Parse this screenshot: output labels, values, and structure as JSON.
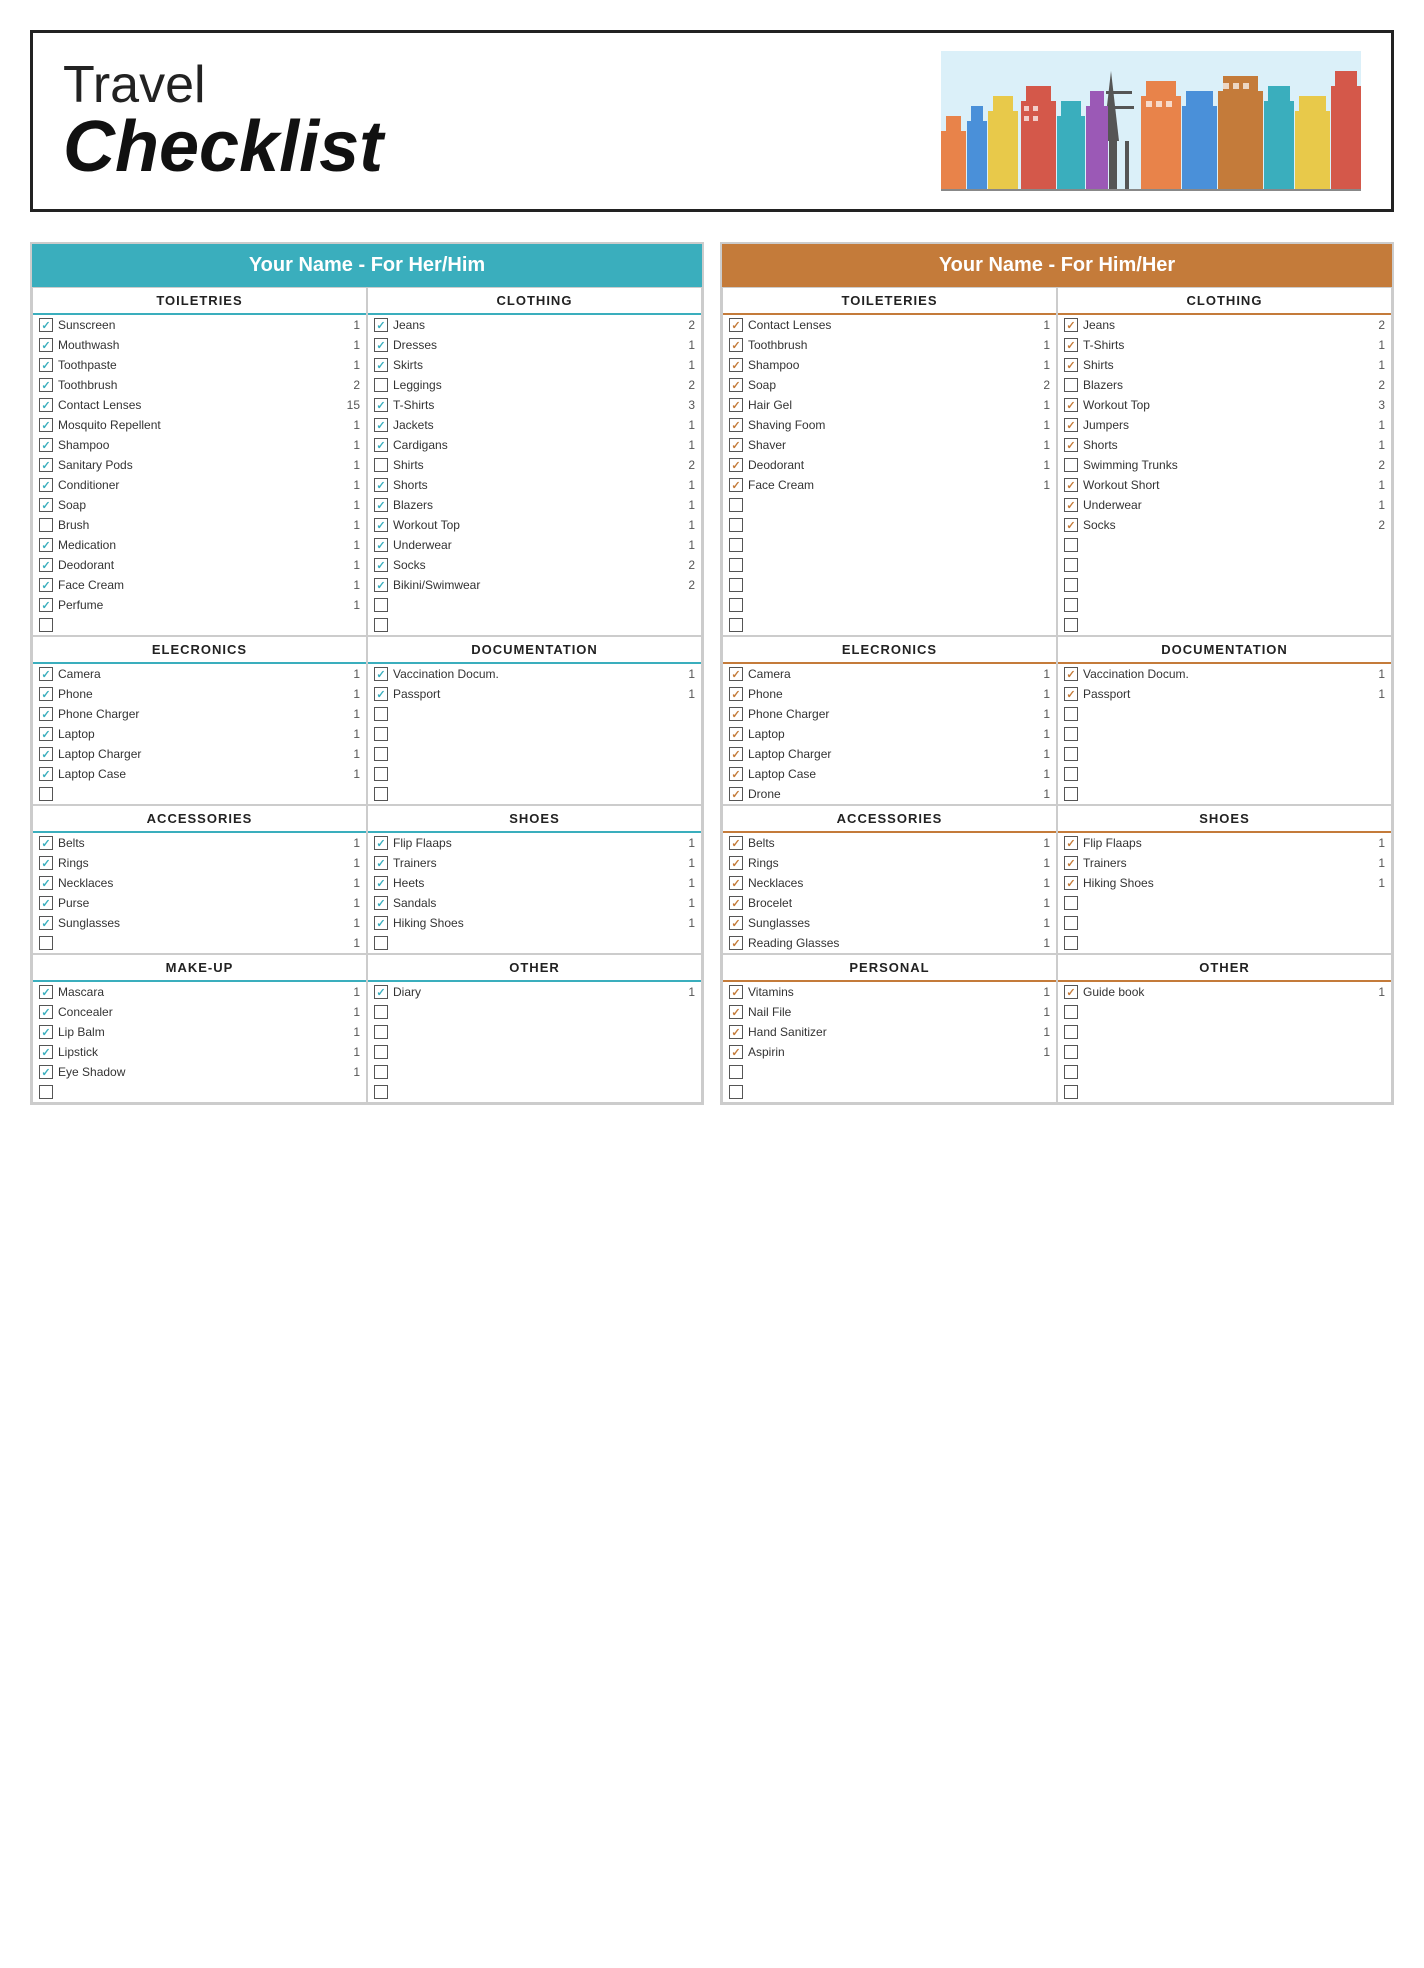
{
  "header": {
    "travel": "Travel",
    "checklist": "Checklist"
  },
  "panels": [
    {
      "id": "her",
      "headerLabel": "Your Name - For Her/Him",
      "headerClass": "blue",
      "sections": [
        {
          "title": "TOILETRIES",
          "titleBorder": "blue",
          "items": [
            {
              "checked": true,
              "name": "Sunscreen",
              "qty": "1"
            },
            {
              "checked": true,
              "name": "Mouthwash",
              "qty": "1"
            },
            {
              "checked": true,
              "name": "Toothpaste",
              "qty": "1"
            },
            {
              "checked": true,
              "name": "Toothbrush",
              "qty": "2"
            },
            {
              "checked": true,
              "name": "Contact Lenses",
              "qty": "15"
            },
            {
              "checked": true,
              "name": "Mosquito Repellent",
              "qty": "1"
            },
            {
              "checked": true,
              "name": "Shampoo",
              "qty": "1"
            },
            {
              "checked": true,
              "name": "Sanitary Pods",
              "qty": "1"
            },
            {
              "checked": true,
              "name": "Conditioner",
              "qty": "1"
            },
            {
              "checked": true,
              "name": "Soap",
              "qty": "1"
            },
            {
              "checked": false,
              "name": "Brush",
              "qty": "1"
            },
            {
              "checked": true,
              "name": "Medication",
              "qty": "1"
            },
            {
              "checked": true,
              "name": "Deodorant",
              "qty": "1"
            },
            {
              "checked": true,
              "name": "Face Cream",
              "qty": "1"
            },
            {
              "checked": true,
              "name": "Perfume",
              "qty": "1"
            },
            {
              "checked": false,
              "name": "",
              "qty": ""
            }
          ]
        },
        {
          "title": "CLOTHING",
          "titleBorder": "blue",
          "items": [
            {
              "checked": true,
              "name": "Jeans",
              "qty": "2"
            },
            {
              "checked": true,
              "name": "Dresses",
              "qty": "1"
            },
            {
              "checked": true,
              "name": "Skirts",
              "qty": "1"
            },
            {
              "checked": false,
              "name": "Leggings",
              "qty": "2"
            },
            {
              "checked": true,
              "name": "T-Shirts",
              "qty": "3"
            },
            {
              "checked": true,
              "name": "Jackets",
              "qty": "1"
            },
            {
              "checked": true,
              "name": "Cardigans",
              "qty": "1"
            },
            {
              "checked": false,
              "name": "Shirts",
              "qty": "2"
            },
            {
              "checked": true,
              "name": "Shorts",
              "qty": "1"
            },
            {
              "checked": true,
              "name": "Blazers",
              "qty": "1"
            },
            {
              "checked": true,
              "name": "Workout Top",
              "qty": "1"
            },
            {
              "checked": true,
              "name": "Underwear",
              "qty": "1"
            },
            {
              "checked": true,
              "name": "Socks",
              "qty": "2"
            },
            {
              "checked": true,
              "name": "Bikini/Swimwear",
              "qty": "2"
            },
            {
              "checked": false,
              "name": "",
              "qty": ""
            },
            {
              "checked": false,
              "name": "",
              "qty": ""
            }
          ]
        },
        {
          "title": "ELECRONICS",
          "titleBorder": "blue",
          "items": [
            {
              "checked": true,
              "name": "Camera",
              "qty": "1"
            },
            {
              "checked": true,
              "name": "Phone",
              "qty": "1"
            },
            {
              "checked": true,
              "name": "Phone Charger",
              "qty": "1"
            },
            {
              "checked": true,
              "name": "Laptop",
              "qty": "1"
            },
            {
              "checked": true,
              "name": "Laptop Charger",
              "qty": "1"
            },
            {
              "checked": true,
              "name": "Laptop Case",
              "qty": "1"
            },
            {
              "checked": false,
              "name": "",
              "qty": ""
            }
          ]
        },
        {
          "title": "DOCUMENTATION",
          "titleBorder": "blue",
          "items": [
            {
              "checked": true,
              "name": "Vaccination Docum.",
              "qty": "1"
            },
            {
              "checked": true,
              "name": "Passport",
              "qty": "1"
            },
            {
              "checked": false,
              "name": "",
              "qty": ""
            },
            {
              "checked": false,
              "name": "",
              "qty": ""
            },
            {
              "checked": false,
              "name": "",
              "qty": ""
            },
            {
              "checked": false,
              "name": "",
              "qty": ""
            },
            {
              "checked": false,
              "name": "",
              "qty": ""
            }
          ]
        },
        {
          "title": "ACCESSORIES",
          "titleBorder": "blue",
          "items": [
            {
              "checked": true,
              "name": "Belts",
              "qty": "1"
            },
            {
              "checked": true,
              "name": "Rings",
              "qty": "1"
            },
            {
              "checked": true,
              "name": "Necklaces",
              "qty": "1"
            },
            {
              "checked": true,
              "name": "Purse",
              "qty": "1"
            },
            {
              "checked": true,
              "name": "Sunglasses",
              "qty": "1"
            },
            {
              "checked": false,
              "name": "",
              "qty": "1"
            }
          ]
        },
        {
          "title": "SHOES",
          "titleBorder": "blue",
          "items": [
            {
              "checked": true,
              "name": "Flip Flaaps",
              "qty": "1"
            },
            {
              "checked": true,
              "name": "Trainers",
              "qty": "1"
            },
            {
              "checked": true,
              "name": "Heets",
              "qty": "1"
            },
            {
              "checked": true,
              "name": "Sandals",
              "qty": "1"
            },
            {
              "checked": true,
              "name": "Hiking Shoes",
              "qty": "1"
            },
            {
              "checked": false,
              "name": "",
              "qty": ""
            }
          ]
        },
        {
          "title": "MAKE-UP",
          "titleBorder": "blue",
          "items": [
            {
              "checked": true,
              "name": "Mascara",
              "qty": "1"
            },
            {
              "checked": true,
              "name": "Concealer",
              "qty": "1"
            },
            {
              "checked": true,
              "name": "Lip Balm",
              "qty": "1"
            },
            {
              "checked": true,
              "name": "Lipstick",
              "qty": "1"
            },
            {
              "checked": true,
              "name": "Eye Shadow",
              "qty": "1"
            },
            {
              "checked": false,
              "name": "",
              "qty": ""
            }
          ]
        },
        {
          "title": "OTHER",
          "titleBorder": "blue",
          "items": [
            {
              "checked": true,
              "name": "Diary",
              "qty": "1"
            },
            {
              "checked": false,
              "name": "",
              "qty": ""
            },
            {
              "checked": false,
              "name": "",
              "qty": ""
            },
            {
              "checked": false,
              "name": "",
              "qty": ""
            },
            {
              "checked": false,
              "name": "",
              "qty": ""
            },
            {
              "checked": false,
              "name": "",
              "qty": ""
            }
          ]
        }
      ]
    },
    {
      "id": "him",
      "headerLabel": "Your Name - For Him/Her",
      "headerClass": "brown",
      "sections": [
        {
          "title": "TOILETERIES",
          "titleBorder": "brown",
          "items": [
            {
              "checked": true,
              "name": "Contact Lenses",
              "qty": "1"
            },
            {
              "checked": true,
              "name": "Toothbrush",
              "qty": "1"
            },
            {
              "checked": true,
              "name": "Shampoo",
              "qty": "1"
            },
            {
              "checked": true,
              "name": "Soap",
              "qty": "2"
            },
            {
              "checked": true,
              "name": "Hair Gel",
              "qty": "1"
            },
            {
              "checked": true,
              "name": "Shaving Foom",
              "qty": "1"
            },
            {
              "checked": true,
              "name": "Shaver",
              "qty": "1"
            },
            {
              "checked": true,
              "name": "Deodorant",
              "qty": "1"
            },
            {
              "checked": true,
              "name": "Face Cream",
              "qty": "1"
            },
            {
              "checked": false,
              "name": "",
              "qty": ""
            },
            {
              "checked": false,
              "name": "",
              "qty": ""
            },
            {
              "checked": false,
              "name": "",
              "qty": ""
            },
            {
              "checked": false,
              "name": "",
              "qty": ""
            },
            {
              "checked": false,
              "name": "",
              "qty": ""
            },
            {
              "checked": false,
              "name": "",
              "qty": ""
            },
            {
              "checked": false,
              "name": "",
              "qty": ""
            }
          ]
        },
        {
          "title": "CLOTHING",
          "titleBorder": "brown",
          "items": [
            {
              "checked": true,
              "name": "Jeans",
              "qty": "2"
            },
            {
              "checked": true,
              "name": "T-Shirts",
              "qty": "1"
            },
            {
              "checked": true,
              "name": "Shirts",
              "qty": "1"
            },
            {
              "checked": false,
              "name": "Blazers",
              "qty": "2"
            },
            {
              "checked": true,
              "name": "Workout Top",
              "qty": "3"
            },
            {
              "checked": true,
              "name": "Jumpers",
              "qty": "1"
            },
            {
              "checked": true,
              "name": "Shorts",
              "qty": "1"
            },
            {
              "checked": false,
              "name": "Swimming Trunks",
              "qty": "2"
            },
            {
              "checked": true,
              "name": "Workout Short",
              "qty": "1"
            },
            {
              "checked": true,
              "name": "Underwear",
              "qty": "1"
            },
            {
              "checked": true,
              "name": "Socks",
              "qty": "2"
            },
            {
              "checked": false,
              "name": "",
              "qty": ""
            },
            {
              "checked": false,
              "name": "",
              "qty": ""
            },
            {
              "checked": false,
              "name": "",
              "qty": ""
            },
            {
              "checked": false,
              "name": "",
              "qty": ""
            },
            {
              "checked": false,
              "name": "",
              "qty": ""
            }
          ]
        },
        {
          "title": "ELECRONICS",
          "titleBorder": "brown",
          "items": [
            {
              "checked": true,
              "name": "Camera",
              "qty": "1"
            },
            {
              "checked": true,
              "name": "Phone",
              "qty": "1"
            },
            {
              "checked": true,
              "name": "Phone Charger",
              "qty": "1"
            },
            {
              "checked": true,
              "name": "Laptop",
              "qty": "1"
            },
            {
              "checked": true,
              "name": "Laptop Charger",
              "qty": "1"
            },
            {
              "checked": true,
              "name": "Laptop Case",
              "qty": "1"
            },
            {
              "checked": true,
              "name": "Drone",
              "qty": "1"
            }
          ]
        },
        {
          "title": "DOCUMENTATION",
          "titleBorder": "brown",
          "items": [
            {
              "checked": true,
              "name": "Vaccination Docum.",
              "qty": "1"
            },
            {
              "checked": true,
              "name": "Passport",
              "qty": "1"
            },
            {
              "checked": false,
              "name": "",
              "qty": ""
            },
            {
              "checked": false,
              "name": "",
              "qty": ""
            },
            {
              "checked": false,
              "name": "",
              "qty": ""
            },
            {
              "checked": false,
              "name": "",
              "qty": ""
            },
            {
              "checked": false,
              "name": "",
              "qty": ""
            }
          ]
        },
        {
          "title": "ACCESSORIES",
          "titleBorder": "brown",
          "items": [
            {
              "checked": true,
              "name": "Belts",
              "qty": "1"
            },
            {
              "checked": true,
              "name": "Rings",
              "qty": "1"
            },
            {
              "checked": true,
              "name": "Necklaces",
              "qty": "1"
            },
            {
              "checked": true,
              "name": "Brocelet",
              "qty": "1"
            },
            {
              "checked": true,
              "name": "Sunglasses",
              "qty": "1"
            },
            {
              "checked": true,
              "name": "Reading Glasses",
              "qty": "1"
            }
          ]
        },
        {
          "title": "SHOES",
          "titleBorder": "brown",
          "items": [
            {
              "checked": true,
              "name": "Flip Flaaps",
              "qty": "1"
            },
            {
              "checked": true,
              "name": "Trainers",
              "qty": "1"
            },
            {
              "checked": true,
              "name": "Hiking Shoes",
              "qty": "1"
            },
            {
              "checked": false,
              "name": "",
              "qty": ""
            },
            {
              "checked": false,
              "name": "",
              "qty": ""
            },
            {
              "checked": false,
              "name": "",
              "qty": ""
            }
          ]
        },
        {
          "title": "PERSONAL",
          "titleBorder": "brown",
          "items": [
            {
              "checked": true,
              "name": "Vitamins",
              "qty": "1"
            },
            {
              "checked": true,
              "name": "Nail File",
              "qty": "1"
            },
            {
              "checked": true,
              "name": "Hand Sanitizer",
              "qty": "1"
            },
            {
              "checked": true,
              "name": "Aspirin",
              "qty": "1"
            },
            {
              "checked": false,
              "name": "",
              "qty": ""
            },
            {
              "checked": false,
              "name": "",
              "qty": ""
            }
          ]
        },
        {
          "title": "OTHER",
          "titleBorder": "brown",
          "items": [
            {
              "checked": true,
              "name": "Guide book",
              "qty": "1"
            },
            {
              "checked": false,
              "name": "",
              "qty": ""
            },
            {
              "checked": false,
              "name": "",
              "qty": ""
            },
            {
              "checked": false,
              "name": "",
              "qty": ""
            },
            {
              "checked": false,
              "name": "",
              "qty": ""
            },
            {
              "checked": false,
              "name": "",
              "qty": ""
            }
          ]
        }
      ]
    }
  ]
}
